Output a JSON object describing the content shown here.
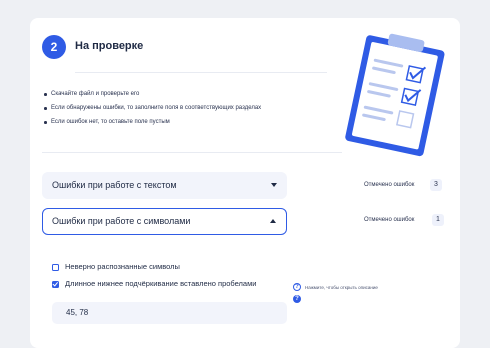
{
  "step": {
    "number": "2",
    "title": "На проверке"
  },
  "instructions": [
    "Скачайте файл и проверьте его",
    "Если обнаружены ошибки, то заполните поля в соответствующих разделах",
    "Если ошибок нет, то оставьте поле пустым"
  ],
  "sections": [
    {
      "label": "Ошибки при работе с текстом",
      "expanded": false,
      "count_label": "Отмечено ошибок",
      "count": "3"
    },
    {
      "label": "Ошибки при работе с символами",
      "expanded": true,
      "count_label": "Отмечено ошибок",
      "count": "1"
    }
  ],
  "options": [
    {
      "label": "Неверно распознанные символы",
      "checked": false
    },
    {
      "label": "Длинное нижнее подчёркивание вставлено пробелами",
      "checked": true
    }
  ],
  "help": {
    "icon": "question-icon",
    "hint": "Нажмите, чтобы открыть описание",
    "mark": "?"
  },
  "value_input": {
    "value": "45, 78"
  },
  "illustration": {
    "icon": "clipboard-checklist-icon"
  },
  "colors": {
    "accent": "#2f5be5",
    "background": "#eef0f4",
    "field": "#f2f4fb"
  }
}
